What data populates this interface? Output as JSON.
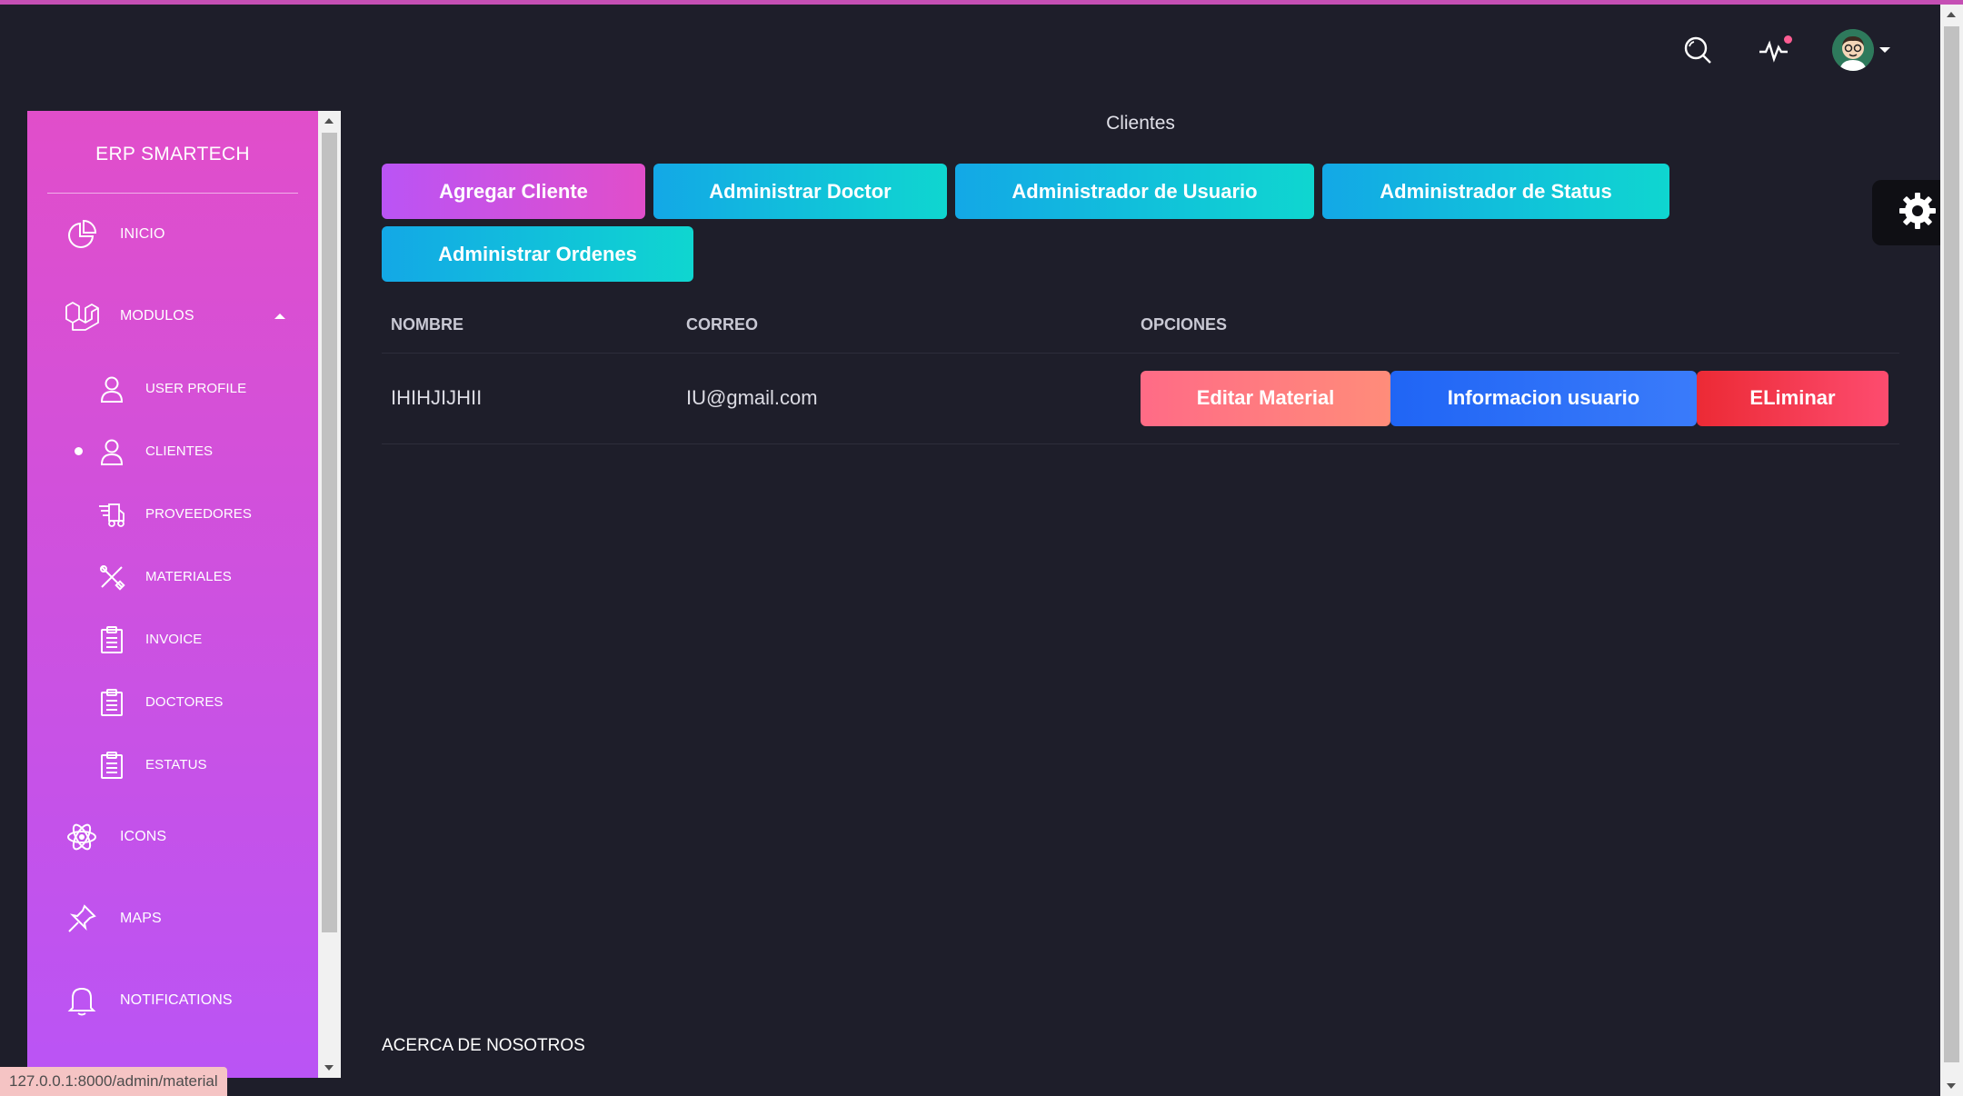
{
  "brand": "ERP SMARTECH",
  "sidebar": {
    "items": [
      {
        "label": "INICIO",
        "icon": "chart-pie-icon"
      },
      {
        "label": "MODULOS",
        "icon": "laravel-icon"
      },
      {
        "label": "USER PROFILE",
        "icon": "user-icon"
      },
      {
        "label": "CLIENTES",
        "icon": "user-icon"
      },
      {
        "label": "PROVEEDORES",
        "icon": "delivery-fast-icon"
      },
      {
        "label": "MATERIALES",
        "icon": "tools-icon"
      },
      {
        "label": "INVOICE",
        "icon": "paper-icon"
      },
      {
        "label": "DOCTORES",
        "icon": "paper-icon"
      },
      {
        "label": "ESTATUS",
        "icon": "paper-icon"
      },
      {
        "label": "ICONS",
        "icon": "atom-icon"
      },
      {
        "label": "MAPS",
        "icon": "pin-icon"
      },
      {
        "label": "NOTIFICATIONS",
        "icon": "bell-icon"
      }
    ]
  },
  "main": {
    "title": "Clientes",
    "buttons": {
      "agregar": "Agregar Cliente",
      "doctor": "Administrar Doctor",
      "usuario": "Administrador de Usuario",
      "status": "Administrador de Status",
      "ordenes": "Administrar Ordenes"
    },
    "table": {
      "headers": [
        "NOMBRE",
        "CORREO",
        "OPCIONES"
      ],
      "rows": [
        {
          "nombre": "IHIHJIJHII",
          "correo": "IU@gmail.com",
          "actions": [
            "Editar Material",
            "Informacion usuario",
            "ELiminar"
          ]
        }
      ]
    }
  },
  "footer": {
    "link": "ACERCA DE NOSOTROS"
  },
  "status_url": "127.0.0.1:8000/admin/material",
  "colors": {
    "background": "#1e1e2a",
    "sidebar_top": "#e14eca",
    "sidebar_bottom": "#ba54f5",
    "info": "#13a8e6",
    "danger": "#ec2a35"
  }
}
